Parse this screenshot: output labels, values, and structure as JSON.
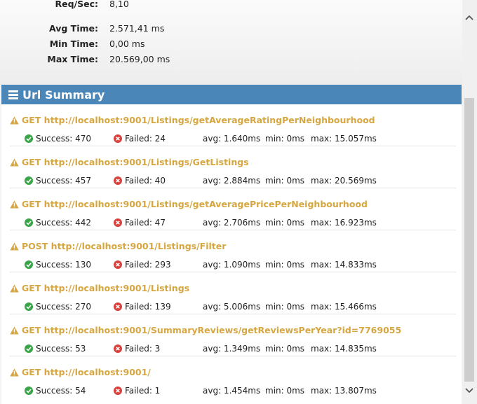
{
  "stats": {
    "req_sec": {
      "label": "Req/Sec:",
      "value": "8,10"
    },
    "avg_time": {
      "label": "Avg Time:",
      "value": "2.571,41 ms"
    },
    "min_time": {
      "label": "Min Time:",
      "value": "0,00 ms"
    },
    "max_time": {
      "label": "Max Time:",
      "value": "20.569,00 ms"
    }
  },
  "url_summary": {
    "title": "Url Summary",
    "items": [
      {
        "title": "GET http://localhost:9001/Listings/getAverageRatingPerNeighbourhood",
        "success": "Success: 470",
        "failed": "Failed: 24",
        "avg": "avg: 1.640ms",
        "min": "min: 0ms",
        "max": "max: 15.057ms"
      },
      {
        "title": "GET http://localhost:9001/Listings/GetListings",
        "success": "Success: 457",
        "failed": "Failed: 40",
        "avg": "avg: 2.884ms",
        "min": "min: 0ms",
        "max": "max: 20.569ms"
      },
      {
        "title": "GET http://localhost:9001/Listings/getAveragePricePerNeighbourhood",
        "success": "Success: 442",
        "failed": "Failed: 47",
        "avg": "avg: 2.706ms",
        "min": "min: 0ms",
        "max": "max: 16.923ms"
      },
      {
        "title": "POST http://localhost:9001/Listings/Filter",
        "success": "Success: 130",
        "failed": "Failed: 293",
        "avg": "avg: 1.090ms",
        "min": "min: 0ms",
        "max": "max: 14.833ms"
      },
      {
        "title": "GET http://localhost:9001/Listings",
        "success": "Success: 270",
        "failed": "Failed: 139",
        "avg": "avg: 5.006ms",
        "min": "min: 0ms",
        "max": "max: 15.466ms"
      },
      {
        "title": "GET http://localhost:9001/SummaryReviews/getReviewsPerYear?id=7769055",
        "success": "Success: 53",
        "failed": "Failed: 3",
        "avg": "avg: 1.349ms",
        "min": "min: 0ms",
        "max": "max: 14.835ms"
      },
      {
        "title": "GET http://localhost:9001/",
        "success": "Success: 54",
        "failed": "Failed: 1",
        "avg": "avg: 1.454ms",
        "min": "min: 0ms",
        "max": "max: 13.807ms"
      }
    ]
  },
  "colors": {
    "header": "#4a86b8",
    "warning": "#d6a640",
    "success": "#3aa548",
    "failed": "#d9413b"
  },
  "icons": {
    "header": "menu-icon",
    "item": "warning-icon",
    "success": "check-circle-icon",
    "failed": "x-circle-icon"
  }
}
